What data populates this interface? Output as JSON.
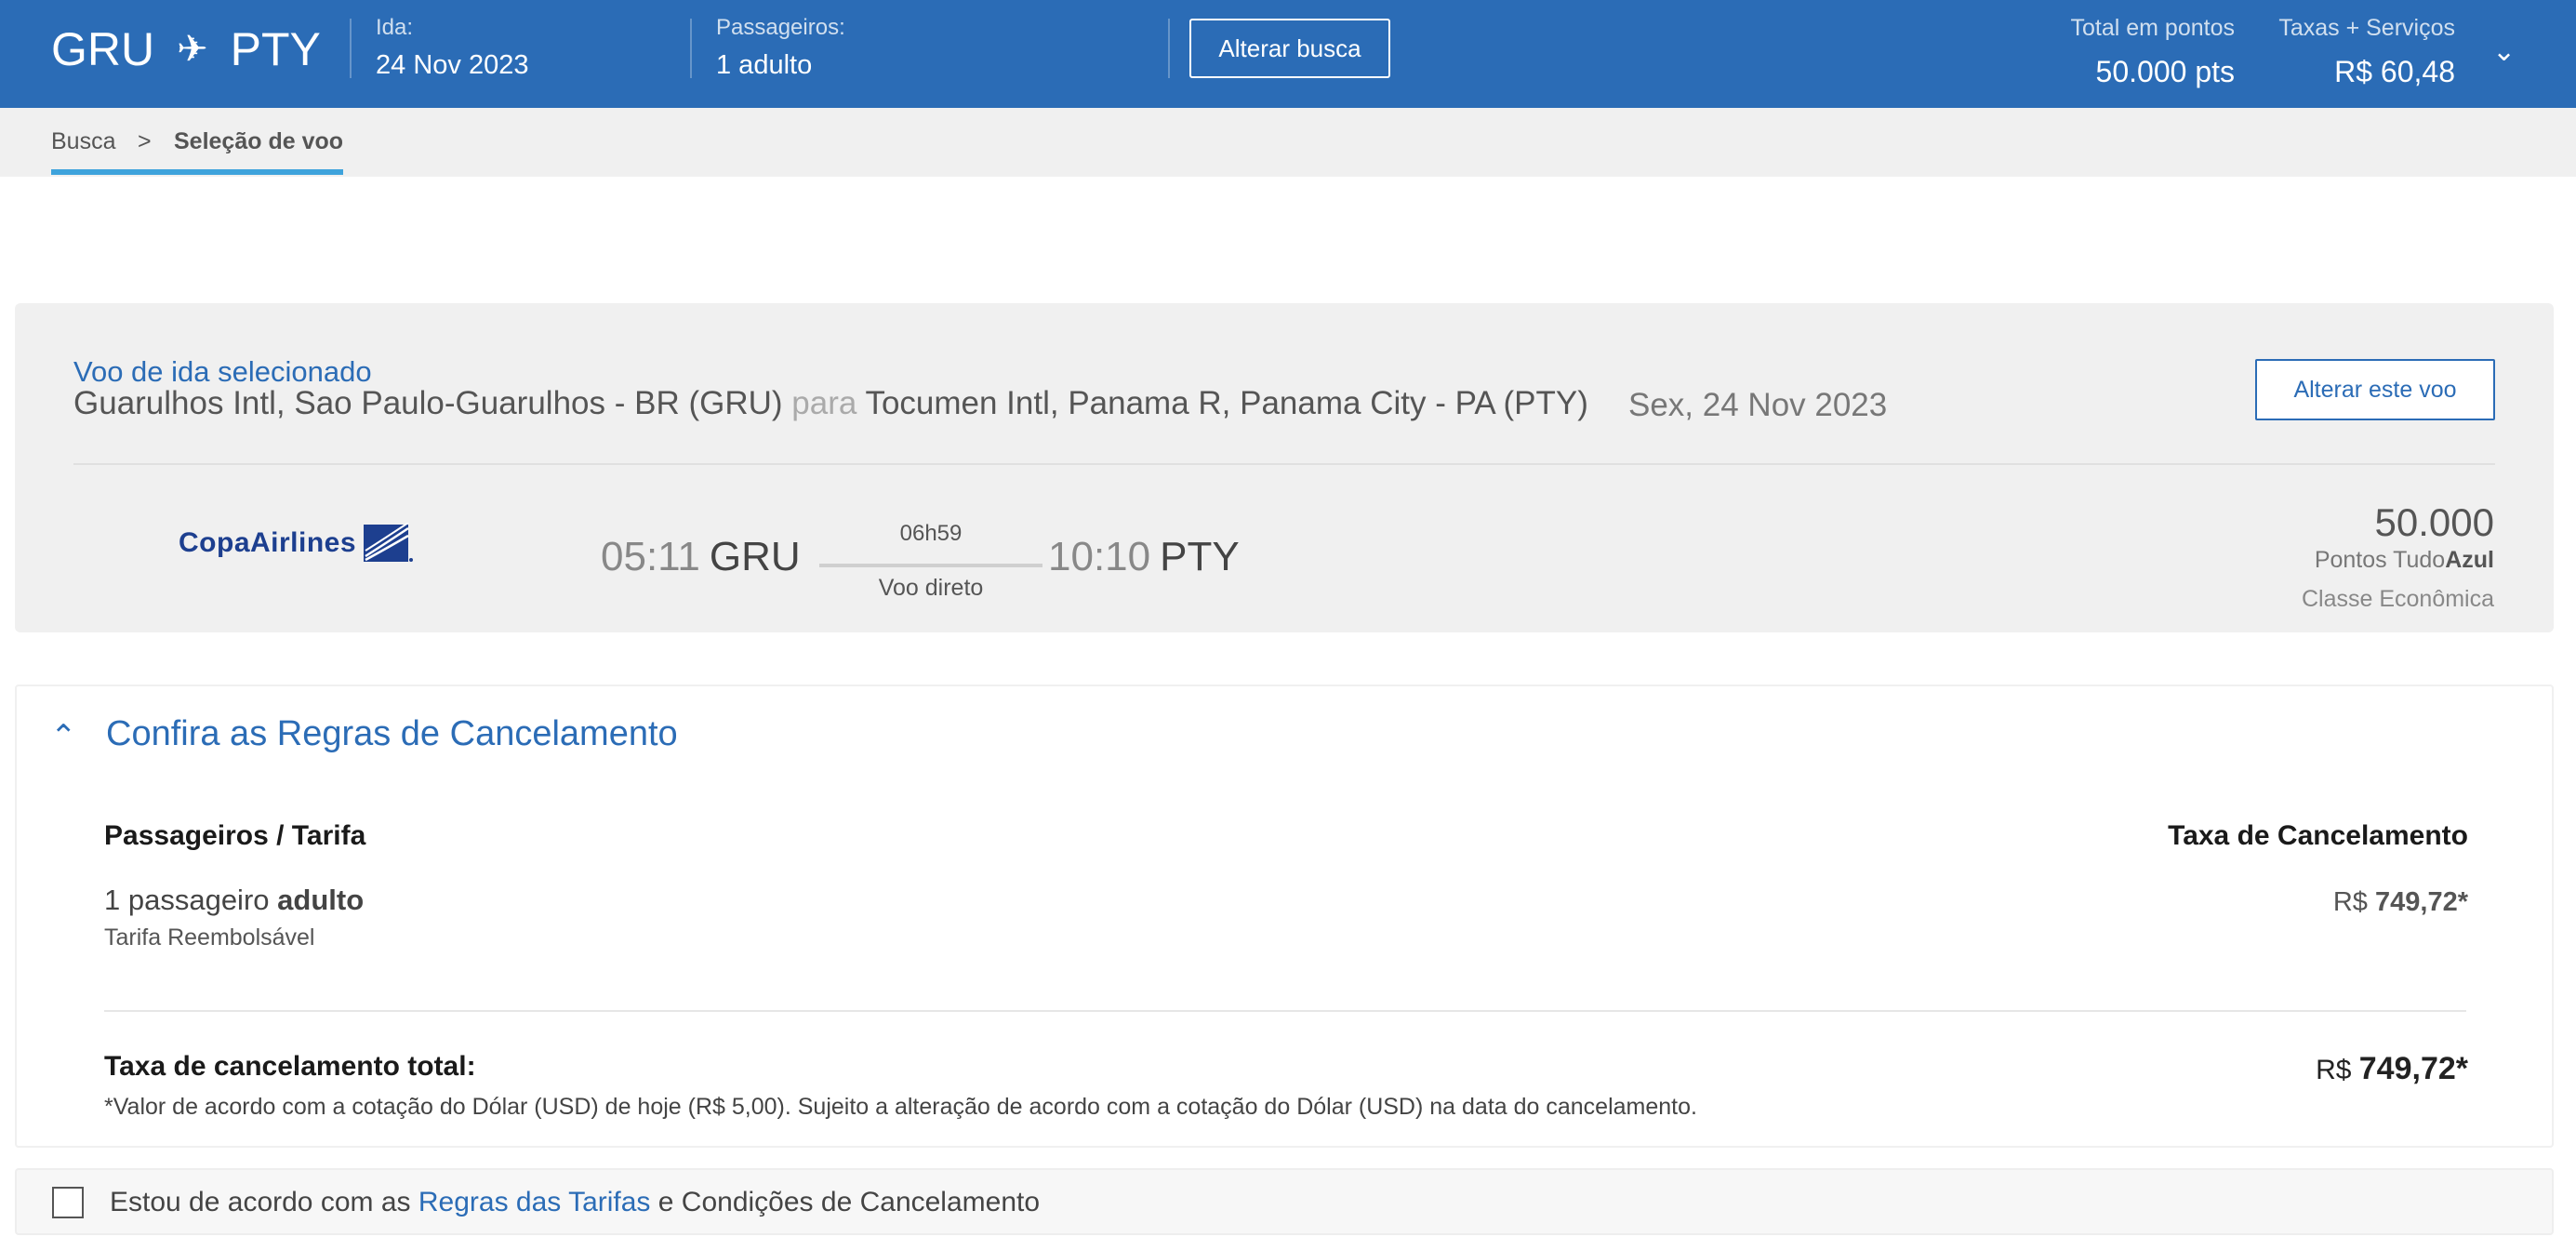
{
  "header": {
    "origin": "GRU",
    "destination": "PTY",
    "departure_label": "Ida:",
    "departure_value": "24 Nov 2023",
    "passengers_label": "Passageiros:",
    "passengers_value": "1 adulto",
    "change_search_label": "Alterar busca",
    "total_points_label": "Total em pontos",
    "total_points_value": "50.000 pts",
    "taxes_label": "Taxas + Serviços",
    "taxes_value": "R$ 60,48"
  },
  "breadcrumb": {
    "items": [
      "Busca",
      "Seleção de voo"
    ],
    "separator": ">"
  },
  "selected_flight": {
    "title": "Voo de ida selecionado",
    "origin_airport": "Guarulhos Intl, Sao Paulo-Guarulhos - BR (GRU)",
    "connector": "para",
    "destination_airport": "Tocumen Intl, Panama R, Panama City - PA (PTY)",
    "date": "Sex, 24 Nov 2023",
    "change_flight_label": "Alterar este voo",
    "airline_logo_text": "CopaAirlines",
    "departure_time": "05:11",
    "departure_code": "GRU",
    "duration": "06h59",
    "stops": "Voo direto",
    "arrival_time": "10:10",
    "arrival_code": "PTY",
    "points": "50.000",
    "points_program_prefix": "Pontos Tudo",
    "points_program_bold": "Azul",
    "cabin_class": "Classe Econômica"
  },
  "cancellation": {
    "title": "Confira as Regras de Cancelamento",
    "col_left": "Passageiros / Tarifa",
    "col_right": "Taxa de Cancelamento",
    "passenger_prefix": "1 passageiro",
    "passenger_type": "adulto",
    "fare_type": "Tarifa Reembolsável",
    "fee_currency": "R$",
    "fee_value": "749,72*",
    "total_label": "Taxa de cancelamento total:",
    "total_currency": "R$",
    "total_value": "749,72*",
    "note": "*Valor de acordo com a cotação do Dólar (USD) de hoje (R$ 5,00). Sujeito a alteração de acordo com a cotação do Dólar (USD) na data do cancelamento."
  },
  "agreement": {
    "prefix": "Estou de acordo com as",
    "link": "Regras das Tarifas",
    "suffix": "e Condições de Cancelamento"
  },
  "icons": {
    "plane": "✈",
    "chevron_down": "⌄",
    "caret_up": "⌃"
  },
  "colors": {
    "header_blue": "#2b6cb6",
    "breadcrumb_underline": "#3ea3dc"
  }
}
